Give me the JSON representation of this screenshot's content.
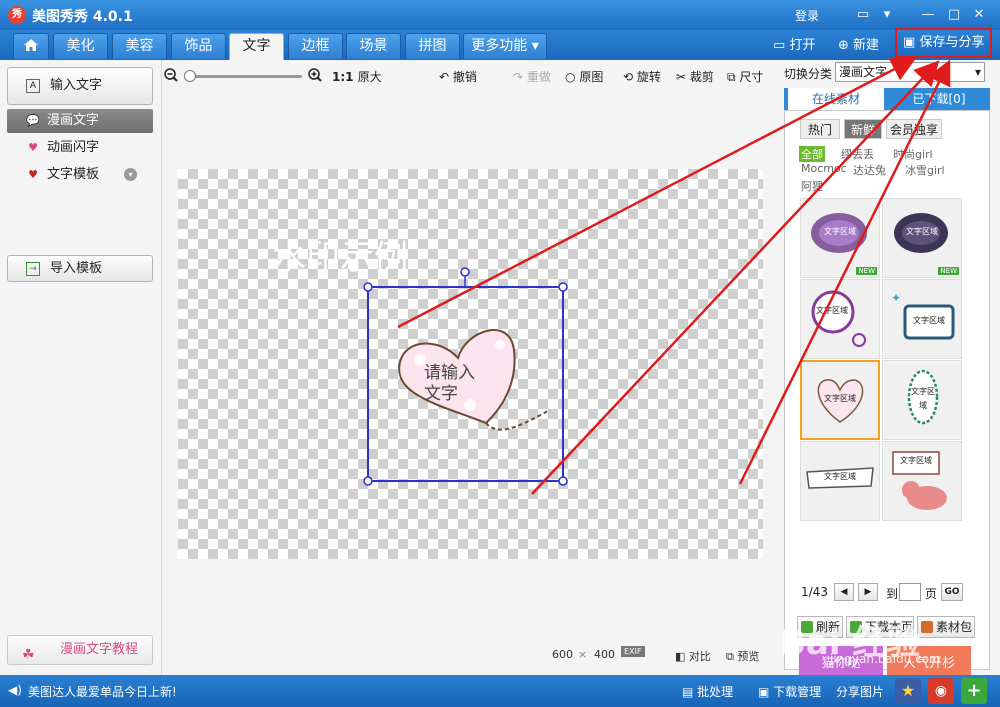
{
  "titlebar": {
    "logo": "秀",
    "title": "美图秀秀 4.0.1",
    "login": "登录"
  },
  "tabs": [
    {
      "label": "美化"
    },
    {
      "label": "美容"
    },
    {
      "label": "饰品"
    },
    {
      "label": "文字"
    },
    {
      "label": "边框"
    },
    {
      "label": "场景"
    },
    {
      "label": "拼图"
    },
    {
      "label": "更多功能 ▾"
    }
  ],
  "top_actions": {
    "open": "打开",
    "new": "新建",
    "save_share": "保存与分享"
  },
  "left_panel": {
    "input_text": "输入文字",
    "items": [
      {
        "label": "漫画文字"
      },
      {
        "label": "动画闪字"
      },
      {
        "label": "文字模板"
      }
    ],
    "import_template": "导入模板",
    "tutorial": "漫画文字教程"
  },
  "toolbar": {
    "ratio": "1:1",
    "original_size": "原大",
    "undo": "撤销",
    "redo": "重做",
    "original": "原图",
    "rotate": "旋转",
    "crop": "裁剪",
    "resize": "尺寸"
  },
  "canvas": {
    "watermark": "水印示例",
    "bubble_line1": "请输入",
    "bubble_line2": "文字",
    "width": "600",
    "times": "×",
    "height": "400",
    "exif": "EXIF",
    "compare": "对比",
    "preview": "预览"
  },
  "right_panel": {
    "category_label": "切换分类",
    "category_value": "漫画文字",
    "tab_online": "在线素材",
    "tab_downloaded": "已下载[0]",
    "pills": [
      "热门",
      "新鲜",
      "会员独享"
    ],
    "filters": [
      "全部",
      "缪丢丢",
      "时尚girl",
      "Mocmoc",
      "达达兔",
      "冰雪girl",
      "阿狸"
    ],
    "thumb_label": "文字区域",
    "new_badge": "NEW",
    "page_indicator": "1/43",
    "goto_label": "到",
    "page_label": "页",
    "go_button": "GO",
    "refresh": "刷新",
    "download_page": "下载本页",
    "material_pack": "素材包",
    "banner_left": "猫你哒",
    "banner_right": "人气开杉"
  },
  "statusbar": {
    "message": "美图达人最爱单品今日上新!",
    "batch": "批处理",
    "download_manager": "下载管理",
    "share_image": "分享图片"
  },
  "watermark": {
    "brand": "Bai 经验",
    "url": "jingyan.baidu.com"
  },
  "colors": {
    "accent_blue": "#1e6fc4",
    "highlight_red": "#e01b1b",
    "selection_blue": "#2a33d0"
  }
}
